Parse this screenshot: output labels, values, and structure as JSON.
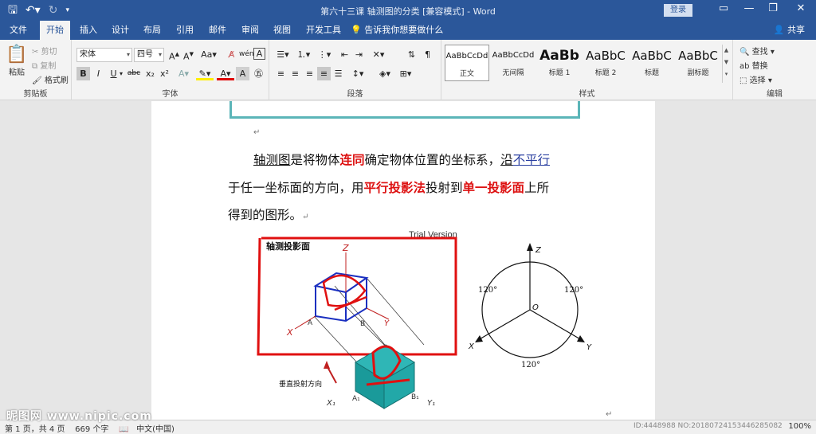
{
  "window": {
    "title": "第六十三课 轴测图的分类 [兼容模式] - Word",
    "login": "登录"
  },
  "qat": {
    "save_icon": "save-icon",
    "undo_icon": "undo-icon",
    "redo_icon": "redo-icon"
  },
  "tabs": [
    "文件",
    "开始",
    "插入",
    "设计",
    "布局",
    "引用",
    "邮件",
    "审阅",
    "视图",
    "开发工具"
  ],
  "tellme": "告诉我你想要做什么",
  "share": "共享",
  "clipboard": {
    "paste": "粘贴",
    "cut": "剪切",
    "copy": "复制",
    "format_painter": "格式刷",
    "label": "剪贴板"
  },
  "font": {
    "name": "宋体",
    "size": "四号",
    "label": "字体",
    "bold": "B",
    "italic": "I",
    "underline": "U",
    "strike": "abc",
    "subscript": "x₂",
    "superscript": "x²"
  },
  "paragraph": {
    "label": "段落"
  },
  "styles": {
    "label": "样式",
    "items": [
      {
        "sample": "AaBbCcDd",
        "name": "正文"
      },
      {
        "sample": "AaBbCcDd",
        "name": "无间隔"
      },
      {
        "sample": "AaBb",
        "name": "标题 1"
      },
      {
        "sample": "AaBbC",
        "name": "标题 2"
      },
      {
        "sample": "AaBbC",
        "name": "标题"
      },
      {
        "sample": "AaBbC",
        "name": "副标题"
      }
    ]
  },
  "editing": {
    "find": "查找",
    "replace": "替换",
    "select": "选择",
    "label": "编辑"
  },
  "document": {
    "line1_a": "轴测图",
    "line1_b": "是将物体",
    "line1_c": "连同",
    "line1_d": "确定物体位置的坐标系，",
    "line1_e": "沿",
    "line1_f": "不平行",
    "line2_a": "于任一坐标面的方向，用",
    "line2_b": "平行投影法",
    "line2_c": "投射到",
    "line2_d": "单一投影面",
    "line2_e": "上所",
    "line3": "得到的图形。",
    "trial": "Trial Version",
    "fig_title": "轴测投影面",
    "fig_caption": "垂直投射方向",
    "angle": "120°"
  },
  "statusbar": {
    "page": "第 1 页，共 4 页",
    "words": "669 个字",
    "lang": "中文(中国)",
    "zoom": "100%",
    "id": "ID:4448988 NO:20180724153446285082"
  },
  "watermark": "昵图网 www.nipic.com"
}
